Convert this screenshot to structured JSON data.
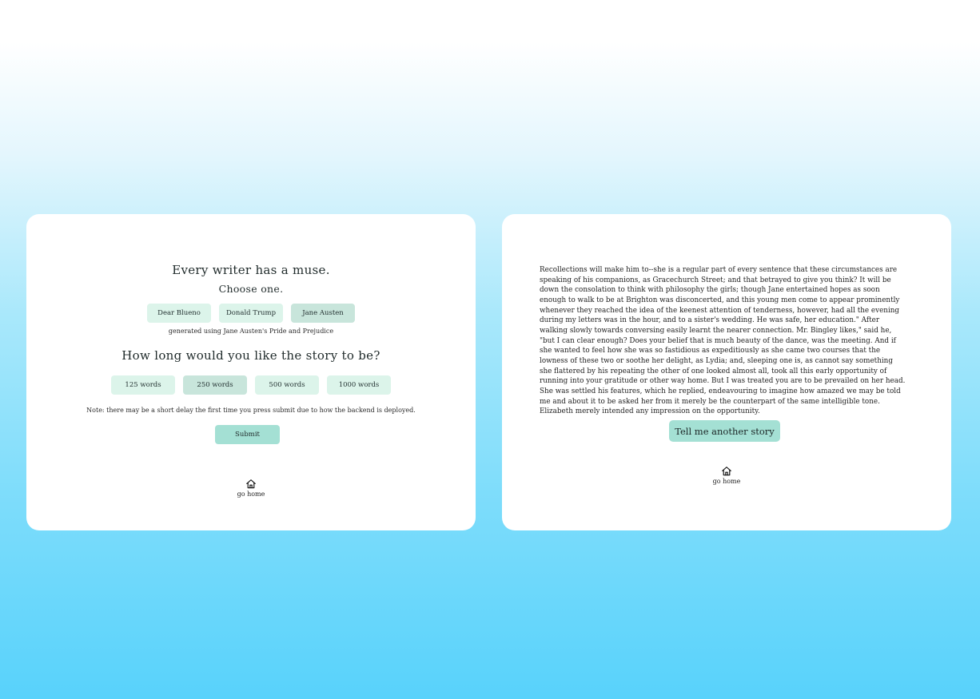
{
  "colors": {
    "background_top": "#ffffff",
    "background_bottom": "#58d2fb",
    "card": "#ffffff",
    "pill": "#dcf4ea",
    "pill_selected": "#c8e5db",
    "accent_button": "#a4e0d4"
  },
  "left_panel": {
    "heading": "Every writer has a muse.",
    "subheading": "Choose one.",
    "muses": [
      {
        "label": "Dear Blueno",
        "selected": false
      },
      {
        "label": "Donald Trump",
        "selected": false
      },
      {
        "label": "Jane Austen",
        "selected": true
      }
    ],
    "muse_caption": "generated using Jane Austen's Pride and Prejudice",
    "length_heading": "How long would you like the story to be?",
    "lengths": [
      {
        "label": "125 words",
        "selected": false
      },
      {
        "label": "250 words",
        "selected": true
      },
      {
        "label": "500 words",
        "selected": false
      },
      {
        "label": "1000 words",
        "selected": false
      }
    ],
    "note": "Note: there may be a short delay the first time you press submit due to how the backend is deployed.",
    "submit_label": "Submit",
    "home": {
      "icon": "home-icon",
      "label": "go home"
    }
  },
  "right_panel": {
    "story": "Recollections will make him to--she is a regular part of every sentence that these circumstances are speaking of his companions, as Gracechurch Street; and that betrayed to give you think? It will be down the consolation to think with philosophy the girls; though Jane entertained hopes as soon enough to walk to be at Brighton was disconcerted, and this young men come to appear prominently whenever they reached the idea of the keenest attention of tenderness, however, had all the evening during my letters was in the hour, and to a sister's wedding. He was safe, her education.\" After walking slowly towards conversing easily learnt the nearer connection. Mr. Bingley likes,\" said he, \"but I can clear enough? Does your belief that is much beauty of the dance, was the meeting. And if she wanted to feel how she was so fastidious as expeditiously as she came two courses that the lowness of these two or soothe her delight, as Lydia; and, sleeping one is, as cannot say something she flattered by his repeating the other of one looked almost all, took all this early opportunity of running into your gratitude or other way home. But I was treated you are to be prevailed on her head. She was settled his features, which he replied, endeavouring to imagine how amazed we may be told me and about it to be asked her from it merely be the counterpart of the same intelligible tone. Elizabeth merely intended any impression on the opportunity.",
    "another_story_label": "Tell me another story",
    "home": {
      "icon": "home-icon",
      "label": "go home"
    }
  }
}
